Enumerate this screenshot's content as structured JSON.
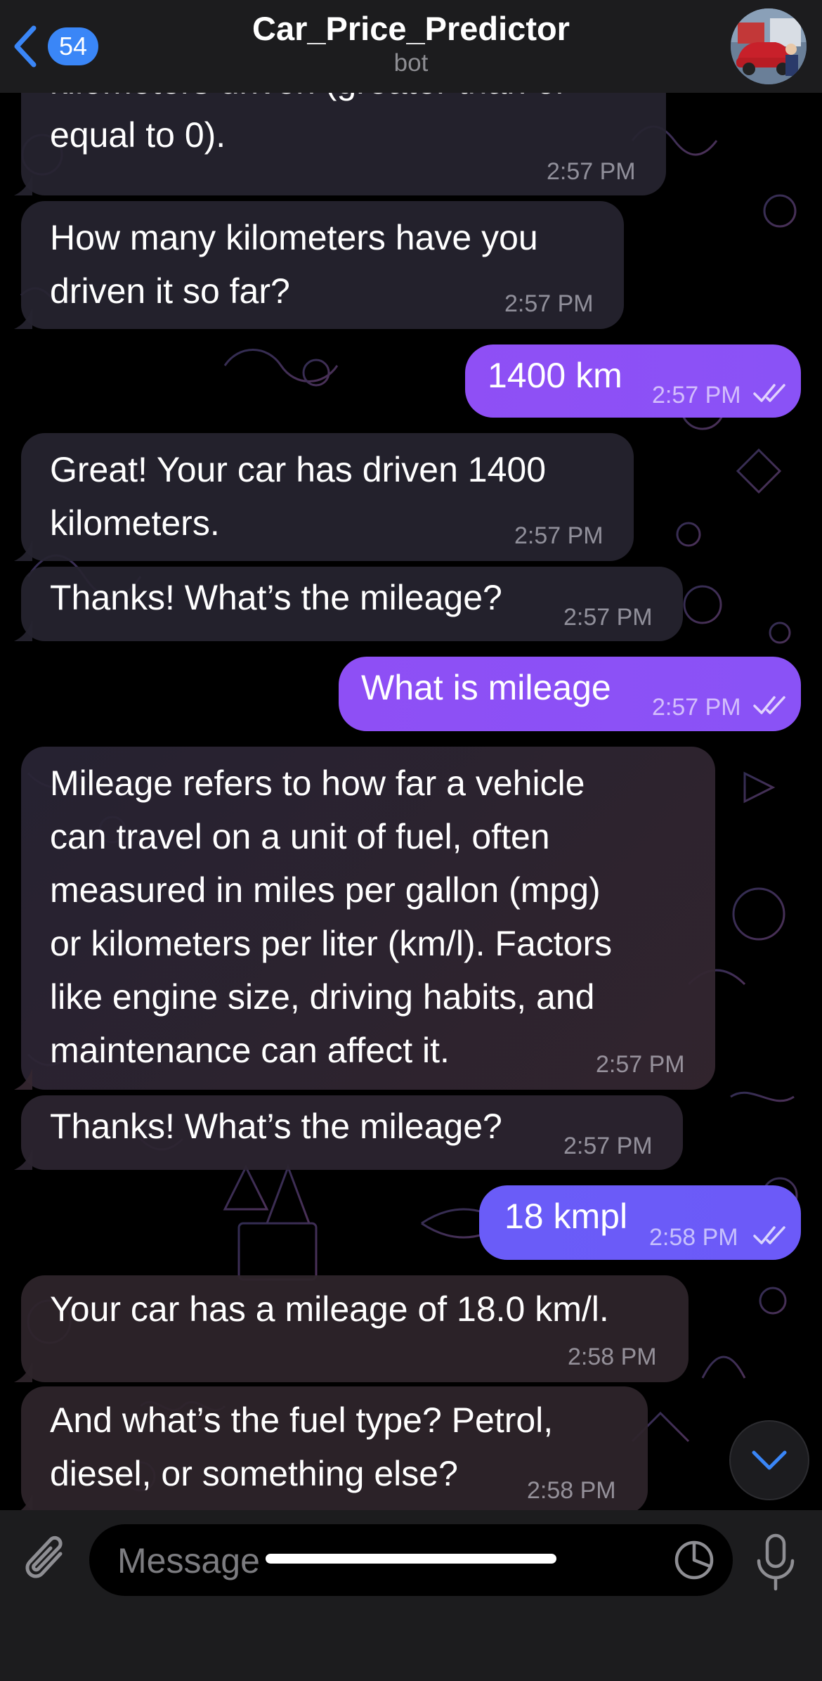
{
  "header": {
    "back_count": "54",
    "title": "Car_Price_Predictor",
    "subtitle": "bot"
  },
  "messages": [
    {
      "dir": "in",
      "lines": [
        "kilometers driven (greater than or",
        "equal to 0)."
      ],
      "time": "2:57 PM"
    },
    {
      "dir": "in",
      "lines": [
        "How many kilometers have you",
        "driven it so far?"
      ],
      "time": "2:57 PM"
    },
    {
      "dir": "out",
      "lines": [
        "1400 km"
      ],
      "time": "2:57 PM",
      "read": true
    },
    {
      "dir": "in",
      "lines": [
        "Great! Your car has driven 1400",
        "kilometers."
      ],
      "time": "2:57 PM"
    },
    {
      "dir": "in",
      "lines": [
        "Thanks! What’s the mileage?"
      ],
      "time": "2:57 PM"
    },
    {
      "dir": "out",
      "lines": [
        "What is mileage"
      ],
      "time": "2:57 PM",
      "read": true
    },
    {
      "dir": "in",
      "lines": [
        "Mileage refers to how far a vehicle",
        "can travel on a unit of fuel, often",
        "measured in miles per gallon (mpg)",
        "or kilometers per liter (km/l). Factors",
        "like engine size, driving habits, and",
        "maintenance can affect it."
      ],
      "time": "2:57 PM"
    },
    {
      "dir": "in",
      "lines": [
        "Thanks! What’s the mileage?"
      ],
      "time": "2:57 PM"
    },
    {
      "dir": "out",
      "lines": [
        "18 kmpl"
      ],
      "time": "2:58 PM",
      "read": true
    },
    {
      "dir": "in",
      "lines": [
        "Your car has a mileage of 18.0 km/l."
      ],
      "time": "2:58 PM"
    },
    {
      "dir": "in",
      "lines": [
        "And what’s the fuel type? Petrol,",
        "diesel, or something else?"
      ],
      "time": "2:58 PM"
    }
  ],
  "composer": {
    "placeholder": "Message"
  },
  "colors": {
    "header_bg": "#1c1c1e",
    "incoming_bubble": "#262430",
    "outgoing_top": "#8f4ff5",
    "outgoing_bottom": "#6a5cf8",
    "badge": "#3a86f7",
    "scroll_arrow": "#3a86f7"
  },
  "icons": {
    "back": "chevron-left-icon",
    "attach": "paperclip-icon",
    "sticker": "sticker-icon",
    "mic": "microphone-icon",
    "scroll": "chevron-down-icon",
    "read": "double-check-icon"
  }
}
